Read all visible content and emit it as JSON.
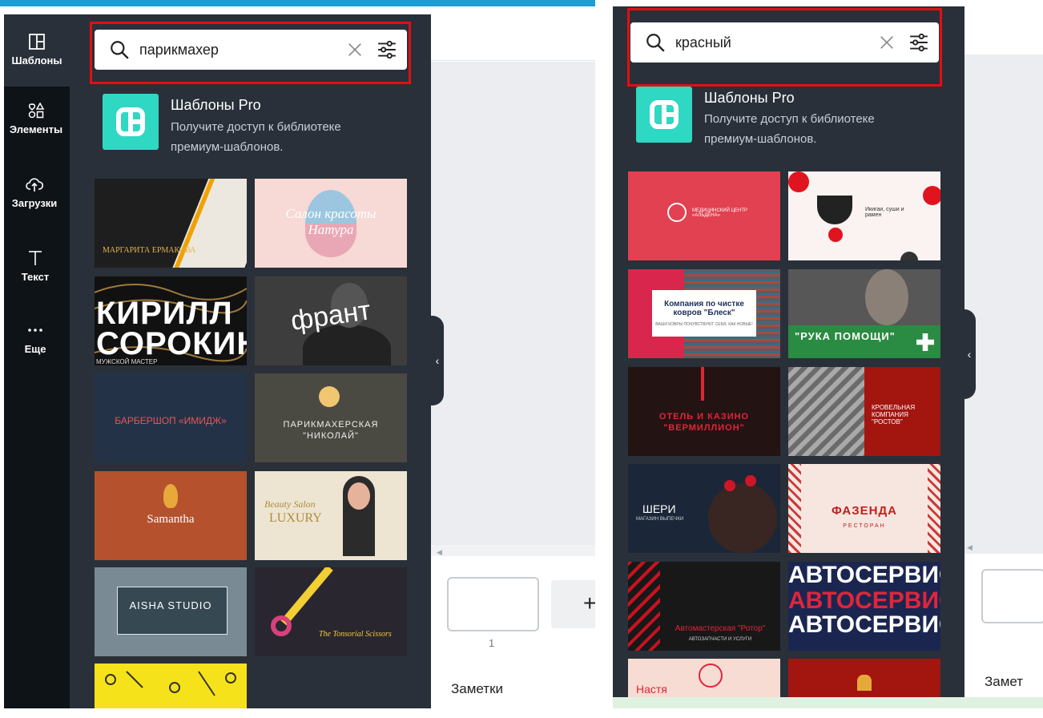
{
  "left": {
    "rail": [
      {
        "label": "Шаблоны",
        "icon": "layout-icon"
      },
      {
        "label": "Элементы",
        "icon": "shapes-icon"
      },
      {
        "label": "Загрузки",
        "icon": "cloud-upload-icon"
      },
      {
        "label": "Текст",
        "icon": "text-icon"
      },
      {
        "label": "Еще",
        "icon": "more-icon"
      }
    ],
    "search": {
      "query": "парикмахер"
    },
    "pro": {
      "title": "Шаблоны Pro",
      "line1": "Получите доступ к библиотеке",
      "line2": "премиум-шаблонов."
    },
    "templates": [
      {
        "text": "МАРГАРИТА ЕРМАКОВА"
      },
      {
        "text": "Салон красоты",
        "text2": "Натура"
      },
      {
        "text": "КИРИЛЛ",
        "text2": "СОРОКИН",
        "text3": "МУЖСКОЙ МАСТЕР"
      },
      {
        "text": "франт"
      },
      {
        "text": "БАРБЕРШОП «ИМИДЖ»"
      },
      {
        "text": "ПАРИКМАХЕРСКАЯ",
        "text2": "\"НИКОЛАЙ\""
      },
      {
        "text": "Samantha"
      },
      {
        "text": "Beauty Salon",
        "text2": "LUXURY"
      },
      {
        "text": "AISHA STUDIO"
      },
      {
        "text": "The Tonsorial Scissors"
      }
    ],
    "page_number": "1",
    "add": "+",
    "notes": "Заметки"
  },
  "right": {
    "search": {
      "query": "красный"
    },
    "pro": {
      "title": "Шаблоны Pro",
      "line1": "Получите доступ к библиотеке",
      "line2": "премиум-шаблонов."
    },
    "templates": [
      {
        "text": "МЕДИЦИНСКИЙ ЦЕНТР «АЛЬДЕНА»"
      },
      {
        "text": "Икигаи, суши и рамен"
      },
      {
        "text": "Компания по чистке ковров \"Блеск\"",
        "text2": "ВАШИ КОВРЫ ПОЧУВСТВУЮТ СЕБЯ, КАК НОВЫЕ!"
      },
      {
        "text": "\"РУКА ПОМОЩИ\""
      },
      {
        "text": "ОТЕЛЬ И КАЗИНО",
        "text2": "\"ВЕРМИЛЛИОН\""
      },
      {
        "text": "КРОВЕЛЬНАЯ КОМПАНИЯ \"РОСТОВ\""
      },
      {
        "text": "ШЕРИ",
        "text2": "МАГАЗИН ВЫПЕЧКИ"
      },
      {
        "text": "ФАЗЕНДА",
        "text2": "РЕСТОРАН"
      },
      {
        "text": "Автомастерская \"Ротор\"",
        "text2": "АВТОЗАПЧАСТИ И УСЛУГИ"
      },
      {
        "text": "АВТОСЕРВИС"
      },
      {
        "text": "Настя"
      }
    ],
    "notes": "Замет"
  },
  "colors": {
    "panel": "#293039",
    "rail": "#0e1318",
    "highlight": "#e01010",
    "pro": "#2ed8c3"
  }
}
